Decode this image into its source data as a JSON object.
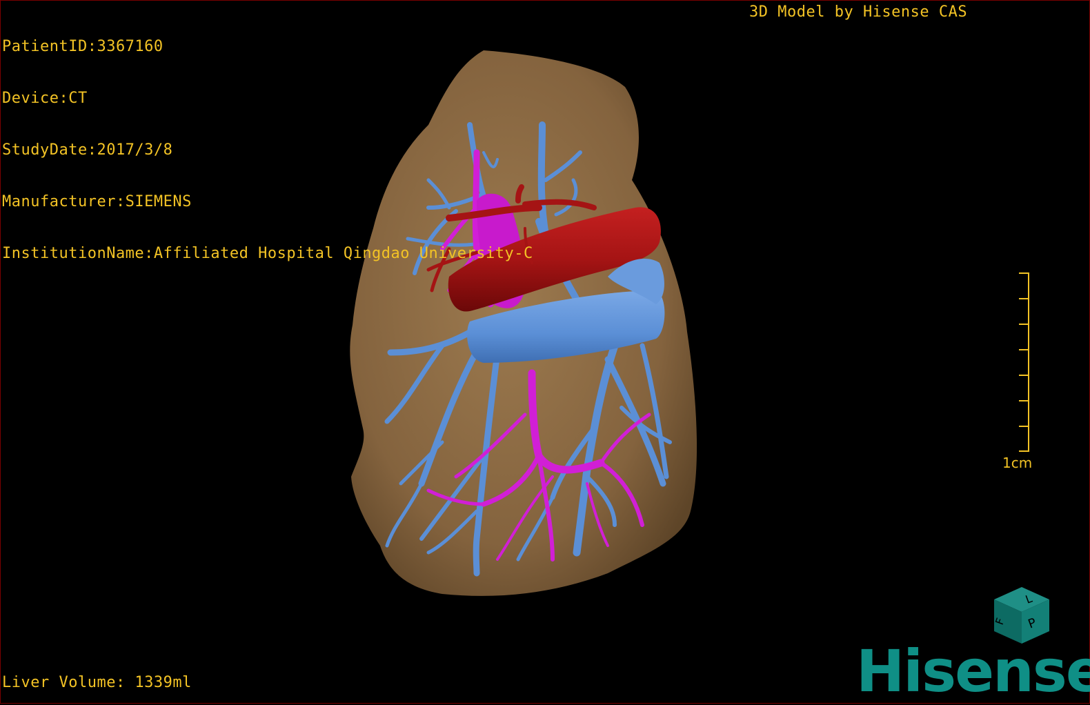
{
  "overlay": {
    "patient_id": "PatientID:3367160",
    "device": "Device:CT",
    "study_date": "StudyDate:2017/3/8",
    "manufacturer": "Manufacturer:SIEMENS",
    "institution": "InstitutionName:Affiliated Hospital Qingdao University-C",
    "brand_caption": "3D Model by Hisense CAS",
    "liver_volume": "Liver Volume: 1339ml",
    "scale_label": "1cm"
  },
  "orientation_cube": {
    "face_front": "P",
    "face_side": "F",
    "face_top": "L"
  },
  "logo_text": "Hisense",
  "colors": {
    "overlay_text": "#f3c325",
    "liver": "#8a6a44",
    "portal_vein": "#5b8fd6",
    "hepatic_artery": "#d11fd6",
    "ivc": "#a51414",
    "logo": "#0f8f86"
  }
}
